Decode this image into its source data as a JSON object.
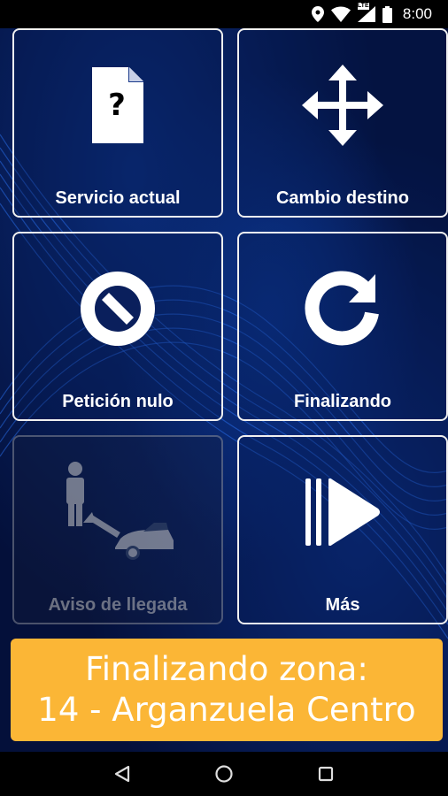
{
  "status_bar": {
    "time": "8:00",
    "network_label": "LTE",
    "icons": [
      "location-icon",
      "wifi-icon",
      "cell-signal-icon",
      "battery-icon"
    ]
  },
  "tiles": [
    {
      "label": "Servicio actual",
      "icon": "document-question-icon",
      "enabled": true
    },
    {
      "label": "Cambio destino",
      "icon": "move-arrows-icon",
      "enabled": true
    },
    {
      "label": "Petición nulo",
      "icon": "prohibited-icon",
      "enabled": true
    },
    {
      "label": "Finalizando",
      "icon": "refresh-icon",
      "enabled": true
    },
    {
      "label": "Aviso de llegada",
      "icon": "person-car-arrival-icon",
      "enabled": false
    },
    {
      "label": "Más",
      "icon": "more-play-icon",
      "enabled": true
    }
  ],
  "banner": {
    "line1": "Finalizando zona:",
    "line2": "14 - Arganzuela Centro",
    "color": "#fbb636"
  },
  "nav_bar": {
    "icons": [
      "back-icon",
      "home-icon",
      "recents-icon"
    ]
  },
  "colors": {
    "background": "#04103a",
    "tile_border": "#f0f0f0",
    "banner": "#fbb636"
  }
}
